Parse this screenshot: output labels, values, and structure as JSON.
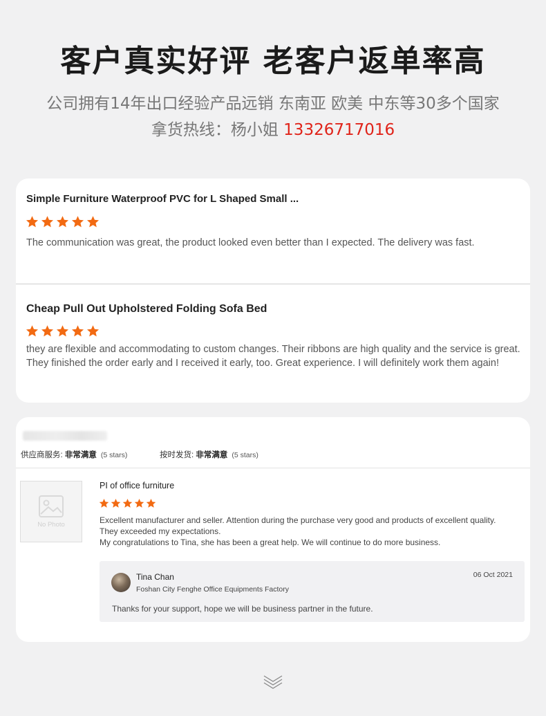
{
  "header": {
    "headline": "客户真实好评 老客户返单率高",
    "subline1": "公司拥有14年出口经验产品远销 东南亚 欧美 中东等30多个国家",
    "subline2_prefix": "拿货热线：杨小姐 ",
    "phone": "13326717016"
  },
  "colors": {
    "star": "#f26a12",
    "phone": "#e0241a"
  },
  "card1": {
    "reviews": [
      {
        "title": "Simple Furniture Waterproof PVC for L Shaped Small ...",
        "rating": 5,
        "body": "The communication was great, the product looked even better than I expected. The delivery was fast."
      },
      {
        "title": "Cheap Pull Out Upholstered Folding Sofa Bed",
        "rating": 5,
        "body": "they are flexible and accommodating to custom changes. Their ribbons are high quality and the service is great. They finished the order early and I received it early, too. Great experience. I will definitely work them again!"
      }
    ]
  },
  "card2": {
    "supplier_service": {
      "label": "供应商服务: ",
      "value": "非常满意",
      "note": "(5 stars)"
    },
    "on_time_shipping": {
      "label": "按时发货: ",
      "value": "非常满意",
      "note": "(5 stars)"
    },
    "thumbnail_text": "No Photo",
    "product_title": "PI of office furniture",
    "rating": 5,
    "body_line1": "Excellent manufacturer and seller. Attention during the purchase very good and products of excellent quality. They exceeded my expectations.",
    "body_line2": "My congratulations to Tina, she has been a great help. We will continue to do more business.",
    "reply": {
      "name": "Tina Chan",
      "company": "Foshan City Fenghe Office Equipments Factory",
      "date": "06 Oct 2021",
      "text": "Thanks for your support, hope we will be business partner in the future."
    }
  }
}
